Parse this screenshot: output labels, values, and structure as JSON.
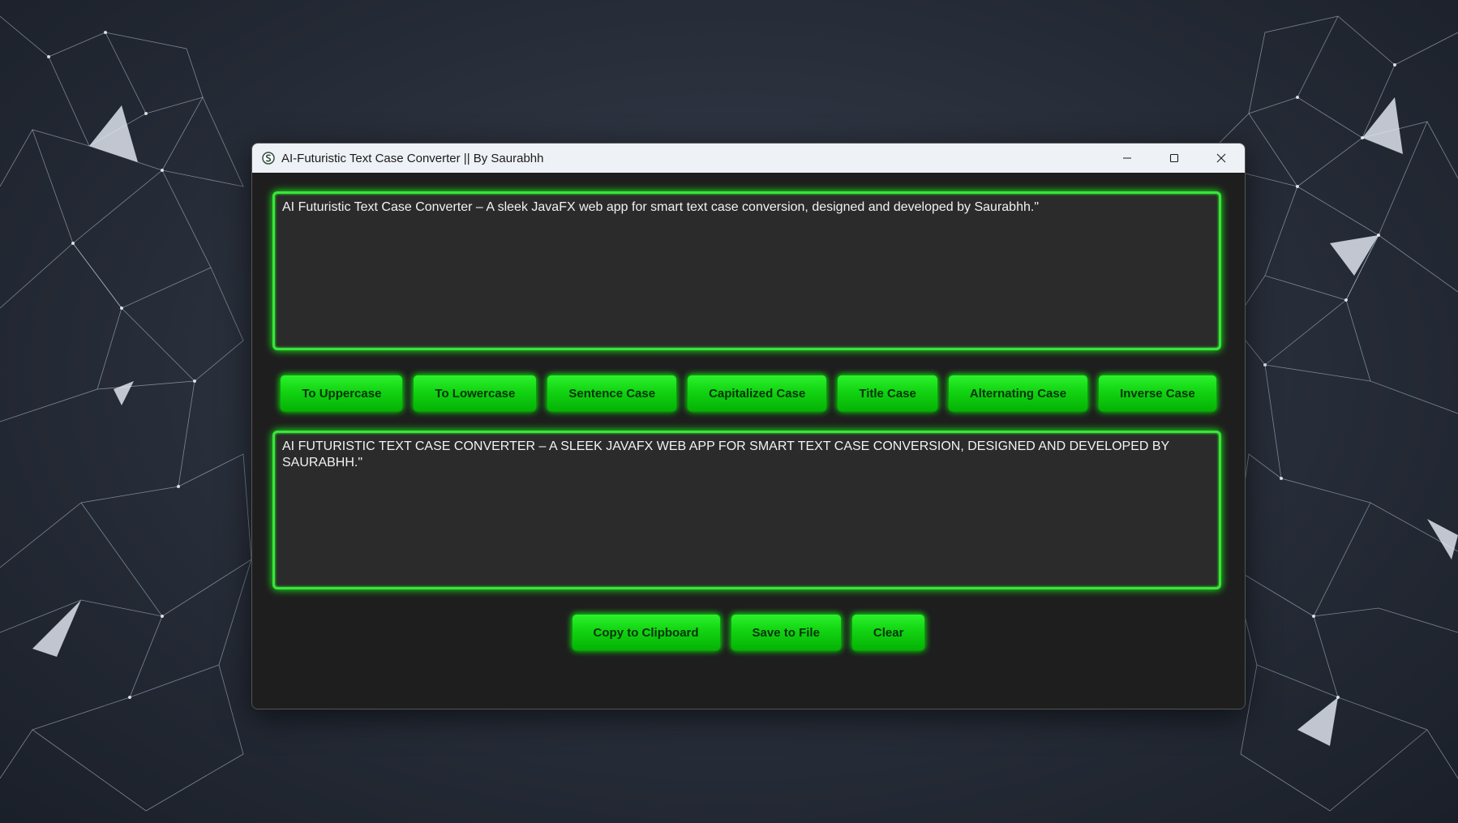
{
  "window": {
    "title": "AI-Futuristic Text Case Converter || By Saurabhh"
  },
  "input": {
    "value": "AI Futuristic Text Case Converter – A sleek JavaFX web app for smart text case conversion, designed and developed by Saurabhh.\""
  },
  "case_buttons": [
    {
      "label": "To Uppercase"
    },
    {
      "label": "To Lowercase"
    },
    {
      "label": "Sentence Case"
    },
    {
      "label": "Capitalized Case"
    },
    {
      "label": "Title Case"
    },
    {
      "label": "Alternating Case"
    },
    {
      "label": "Inverse Case"
    }
  ],
  "output": {
    "value": "AI FUTURISTIC TEXT CASE CONVERTER – A SLEEK JAVAFX WEB APP FOR SMART TEXT CASE CONVERSION, DESIGNED AND DEVELOPED BY SAURABHH.\""
  },
  "action_buttons": [
    {
      "label": "Copy to Clipboard"
    },
    {
      "label": "Save to File"
    },
    {
      "label": "Clear"
    }
  ],
  "icons": {
    "app": "app-logo-icon",
    "minimize": "minimize-icon",
    "maximize": "maximize-icon",
    "close": "close-icon"
  },
  "colors": {
    "accent_green": "#39e639",
    "button_text": "#07330a",
    "panel_bg": "#1e1e1e",
    "textarea_bg": "#2b2b2b"
  }
}
